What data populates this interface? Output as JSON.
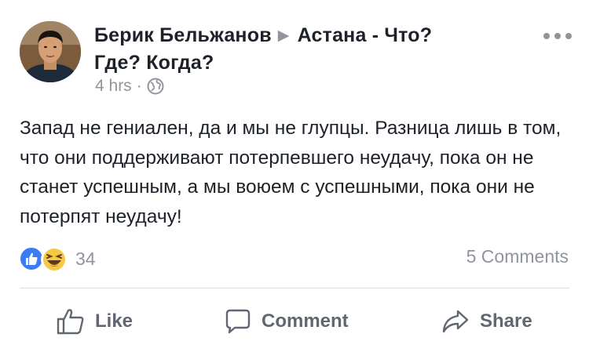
{
  "post": {
    "author": "Берик Бельжанов",
    "group_line1": "Астана - Что?",
    "group_line2": "Где? Когда?",
    "time": "4 hrs",
    "separator": "·",
    "text": "Запад не гениален, да и мы не глупцы. Разница лишь в том, что они поддерживают потерпевшего неудачу, пока он не станет успешным, а мы воюем с успешными, пока они не потерпят неудачу!"
  },
  "stats": {
    "reactions_count": "34",
    "comments_label": "5 Comments"
  },
  "actions": {
    "like": "Like",
    "comment": "Comment",
    "share": "Share"
  },
  "icons": {
    "arrow": "right-triangle-icon",
    "privacy": "globe-icon",
    "more": "more-horizontal-icon",
    "like_reaction": "like-reaction-icon",
    "haha_reaction": "haha-reaction-icon"
  },
  "colors": {
    "text": "#1d2129",
    "secondary": "#90949c",
    "action": "#606770",
    "like_blue": "#3b7cf2",
    "divider": "#dadde1"
  }
}
